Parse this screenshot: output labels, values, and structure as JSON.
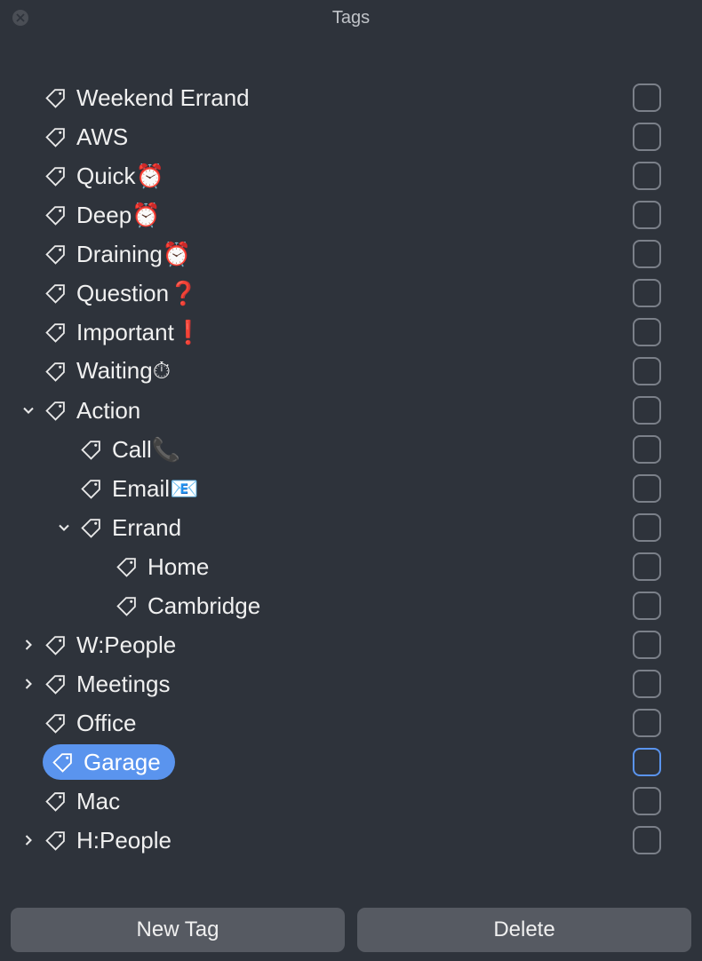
{
  "title": "Tags",
  "tags": [
    {
      "label": "Weekend Errand",
      "indent": 0,
      "disclosure": null,
      "selected": false
    },
    {
      "label": "AWS",
      "indent": 0,
      "disclosure": null,
      "selected": false
    },
    {
      "label": "Quick⏰",
      "indent": 0,
      "disclosure": null,
      "selected": false
    },
    {
      "label": "Deep⏰",
      "indent": 0,
      "disclosure": null,
      "selected": false
    },
    {
      "label": "Draining⏰",
      "indent": 0,
      "disclosure": null,
      "selected": false
    },
    {
      "label": "Question❓",
      "indent": 0,
      "disclosure": null,
      "selected": false
    },
    {
      "label": "Important❗",
      "indent": 0,
      "disclosure": null,
      "selected": false
    },
    {
      "label": "Waiting⏱",
      "indent": 0,
      "disclosure": null,
      "selected": false
    },
    {
      "label": "Action",
      "indent": 0,
      "disclosure": "open",
      "selected": false
    },
    {
      "label": "Call📞",
      "indent": 1,
      "disclosure": null,
      "selected": false
    },
    {
      "label": "Email📧",
      "indent": 1,
      "disclosure": null,
      "selected": false
    },
    {
      "label": "Errand",
      "indent": 1,
      "disclosure": "open",
      "selected": false
    },
    {
      "label": "Home",
      "indent": 2,
      "disclosure": null,
      "selected": false
    },
    {
      "label": "Cambridge",
      "indent": 2,
      "disclosure": null,
      "selected": false
    },
    {
      "label": "W:People",
      "indent": 0,
      "disclosure": "closed",
      "selected": false
    },
    {
      "label": "Meetings",
      "indent": 0,
      "disclosure": "closed",
      "selected": false
    },
    {
      "label": "Office",
      "indent": 0,
      "disclosure": null,
      "selected": false
    },
    {
      "label": "Garage",
      "indent": 0,
      "disclosure": null,
      "selected": true
    },
    {
      "label": "Mac",
      "indent": 0,
      "disclosure": null,
      "selected": false
    },
    {
      "label": "H:People",
      "indent": 0,
      "disclosure": "closed",
      "selected": false
    }
  ],
  "footer": {
    "new_tag": "New Tag",
    "delete": "Delete"
  }
}
